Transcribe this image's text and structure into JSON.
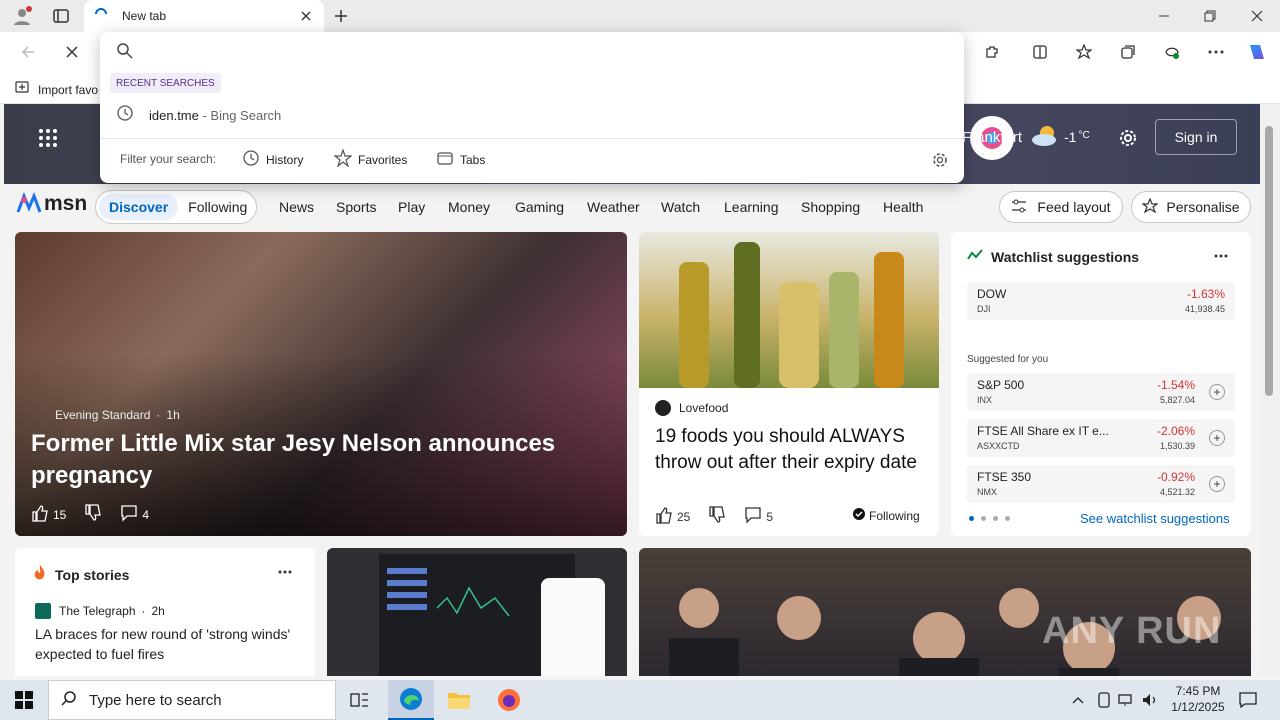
{
  "browser": {
    "tab_title": "New tab",
    "favorites_bar_label": "Import favo"
  },
  "dropdown": {
    "recent_header": "RECENT SEARCHES",
    "recent_query": "iden.tme",
    "recent_suffix": " - Bing Search",
    "filter_label": "Filter your search:",
    "filters": [
      "History",
      "Favorites",
      "Tabs"
    ]
  },
  "header": {
    "location": "Frankfurt",
    "temperature": "-1",
    "temp_unit": "°C",
    "sign_in": "Sign in"
  },
  "msn_nav": {
    "logo": "msn",
    "tabs": [
      "Discover",
      "Following"
    ],
    "items": [
      "News",
      "Sports",
      "Play",
      "Money",
      "Gaming",
      "Weather",
      "Watch",
      "Learning",
      "Shopping",
      "Health"
    ],
    "feed_layout": "Feed layout",
    "personalise": "Personalise"
  },
  "hero": {
    "source": "Evening Standard",
    "age": "1h",
    "title": "Former Little Mix star Jesy Nelson announces pregnancy",
    "likes": "15",
    "comments": "4"
  },
  "food_card": {
    "source": "Lovefood",
    "title": "19 foods you should ALWAYS throw out after their expiry date",
    "likes": "25",
    "comments": "5",
    "following": "Following"
  },
  "watchlist": {
    "title": "Watchlist suggestions",
    "main": {
      "name": "DOW",
      "symbol": "DJI",
      "change": "-1.63%",
      "value": "41,938.45"
    },
    "suggested_label": "Suggested for you",
    "stocks": [
      {
        "name": "S&P 500",
        "symbol": "INX",
        "change": "-1.54%",
        "value": "5,827.04"
      },
      {
        "name": "FTSE All Share ex IT e...",
        "symbol": "ASXXCTD",
        "change": "-2.06%",
        "value": "1,530.39"
      },
      {
        "name": "FTSE 350",
        "symbol": "NMX",
        "change": "-0.92%",
        "value": "4,521.32"
      }
    ],
    "see_more": "See watchlist suggestions"
  },
  "top_stories": {
    "title": "Top stories",
    "source": "The Telegraph",
    "age": "2h",
    "headline": "LA braces for new round of 'strong winds' expected to fuel fires"
  },
  "watermark": "ANY RUN",
  "taskbar": {
    "search_placeholder": "Type here to search",
    "time": "7:45 PM",
    "date": "1/12/2025"
  },
  "colors": {
    "accent": "#0067c0",
    "negative": "#d13438"
  }
}
